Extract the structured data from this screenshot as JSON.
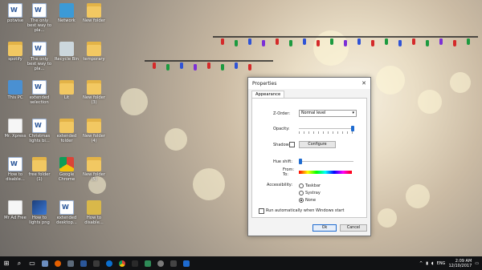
{
  "desktop": {
    "icons": [
      {
        "label": "potwise",
        "type": "doc"
      },
      {
        "label": "The only best way to pla...",
        "type": "doc"
      },
      {
        "label": "Network",
        "type": "net"
      },
      {
        "label": "New folder",
        "type": "folder"
      },
      {
        "label": "spotify",
        "type": "folder"
      },
      {
        "label": "The only best way to pla...",
        "type": "doc"
      },
      {
        "label": "Recycle Bin",
        "type": "bin"
      },
      {
        "label": "temporary",
        "type": "folder"
      },
      {
        "label": "This PC",
        "type": "pc"
      },
      {
        "label": "extended selection",
        "type": "doc"
      },
      {
        "label": "Lit",
        "type": "folder"
      },
      {
        "label": "New folder (3)",
        "type": "folder"
      },
      {
        "label": "Mr. Xpress",
        "type": "app"
      },
      {
        "label": "Christmas lights bi...",
        "type": "doc"
      },
      {
        "label": "extended folder",
        "type": "folder"
      },
      {
        "label": "New folder (4)",
        "type": "folder"
      },
      {
        "label": "How to disable...",
        "type": "doc"
      },
      {
        "label": "free folder (1)",
        "type": "folder"
      },
      {
        "label": "Google Chrome",
        "type": "chrome"
      },
      {
        "label": "New folder (5)",
        "type": "folder"
      },
      {
        "label": "Mr Ad Free",
        "type": "app"
      },
      {
        "label": "How to lights png",
        "type": "img"
      },
      {
        "label": "extended desktop...",
        "type": "doc"
      },
      {
        "label": "How to disable...",
        "type": "zip"
      }
    ]
  },
  "dialog": {
    "title": "Properties",
    "close_glyph": "✕",
    "tab_label": "Appearance",
    "zorder_label": "Z-Order:",
    "zorder_value": "Normal level",
    "opacity_label": "Opacity:",
    "shadow_label": "Shadow:",
    "configure_label": "Configure",
    "hue_label": "Hue shift:",
    "from_label": "From:",
    "to_label": "To:",
    "accessibility_label": "Accessibility:",
    "radio_options": [
      "Taskbar",
      "Systray",
      "None"
    ],
    "run_auto_label": "Run automatically when Windows start",
    "ok_label": "Ok",
    "cancel_label": "Cancel"
  },
  "taskbar": {
    "language": "ENG",
    "time": "2:09 AM",
    "date": "12/10/2017"
  },
  "colors": {
    "accent": "#1e6bd0",
    "taskbar_bg": "#111214"
  }
}
